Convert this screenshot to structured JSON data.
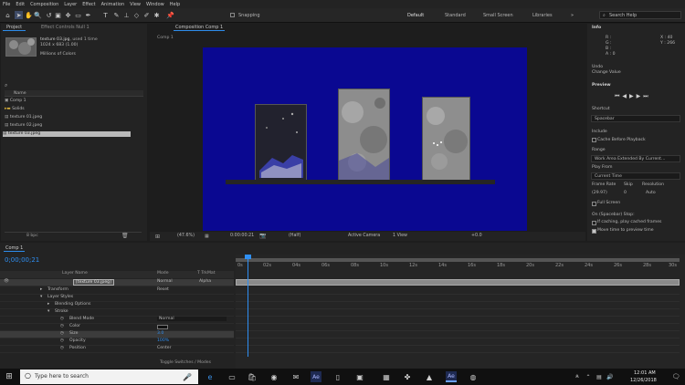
{
  "menu": [
    "File",
    "Edit",
    "Composition",
    "Layer",
    "Effect",
    "Animation",
    "View",
    "Window",
    "Help"
  ],
  "toolbar": {
    "snapping": "Snapping",
    "workspaces": [
      "Default",
      "Standard",
      "Small Screen",
      "Libraries"
    ],
    "search_placeholder": "Search Help"
  },
  "project": {
    "tabs": [
      "Project",
      "Effect Controls Null 1"
    ],
    "selected_name": "texture 03.jpg",
    "used": ", used 1 time",
    "dims": "1024 x 683 (1.00)",
    "colors": "Millions of Colors",
    "col_name": "Name",
    "items": [
      "Comp 1",
      "Solids",
      "texture 01.jpeg",
      "texture 02.jpeg",
      "texture 03.jpeg"
    ],
    "bpc": "8 bpc"
  },
  "comp": {
    "tab": "Composition Comp 1",
    "crumb": "Comp 1",
    "zoom": "(47.6%)",
    "time": "0:00:00:21",
    "quality": "(Half)",
    "camera": "Active Camera",
    "view": "1 View",
    "exposure": "+0.0"
  },
  "info": {
    "title": "Info",
    "r": "R :",
    "g": "G :",
    "b": "B :",
    "a": "A : 0",
    "x": "X : 40",
    "y": "Y : 266",
    "undo": "Undo",
    "change": "Change Value"
  },
  "preview": {
    "title": "Preview",
    "shortcut_label": "Shortcut",
    "shortcut": "Spacebar",
    "include": "Include",
    "cache": "Cache Before Playback",
    "range_label": "Range",
    "range": "Work Area Extended By Current...",
    "play_from_label": "Play From",
    "play_from": "Current Time",
    "frame_rate": "Frame Rate",
    "skip": "Skip",
    "resolution": "Resolution",
    "fr_val": "(29.97)",
    "skip_val": "0",
    "res_val": "Auto",
    "full_screen": "Full Screen",
    "on_stop": "On (Spacebar) Stop:",
    "if_caching": "If caching, play cached frames",
    "move_time": "Move time to preview time"
  },
  "timeline": {
    "tab": "Comp 1",
    "timecode": "0;00;00;21",
    "headers": [
      "Layer Name",
      "Mode",
      "T TrkMat"
    ],
    "layer": "[texture 03.jpeg]",
    "mode": "Normal",
    "trkmat": "Alpha",
    "props": [
      "Transform",
      "Layer Styles",
      "Blending Options",
      "Stroke",
      "Blend Mode",
      "Color",
      "Size",
      "Opacity",
      "Position"
    ],
    "prop_vals": [
      "Reset",
      "",
      "",
      "",
      "Normal",
      "",
      "3.0",
      "100%",
      "Center"
    ],
    "toggle": "Toggle Switches / Modes",
    "ticks": [
      "0s",
      "02s",
      "04s",
      "06s",
      "08s",
      "10s",
      "12s",
      "14s",
      "16s",
      "18s",
      "20s",
      "22s",
      "24s",
      "26s",
      "28s",
      "30s"
    ]
  },
  "taskbar": {
    "search": "Type here to search",
    "time": "12:01 AM",
    "date": "12/26/2018"
  }
}
